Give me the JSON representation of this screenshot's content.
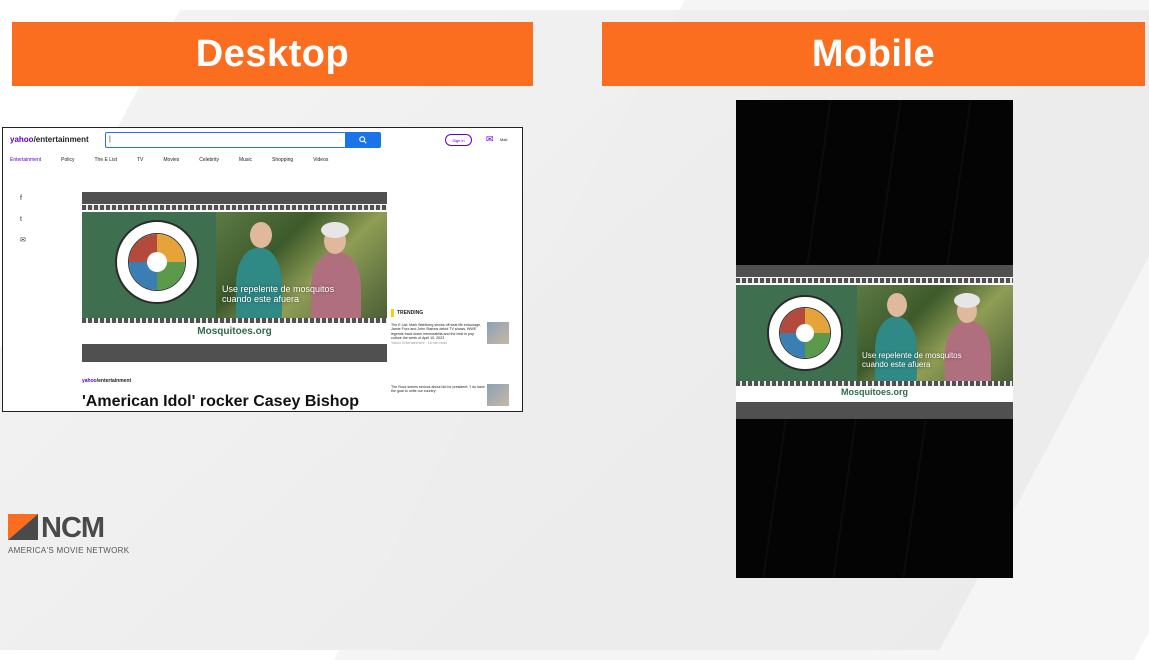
{
  "headers": {
    "desktop": "Desktop",
    "mobile": "Mobile"
  },
  "desktop": {
    "brand_prefix": "yahoo",
    "brand_rest": "/entertainment",
    "search_value": "|",
    "search_icon": "search-icon",
    "signin": "Sign in",
    "mail": "Mail",
    "nav": [
      "Entertainment",
      "Policy",
      "The E List",
      "TV",
      "Movies",
      "Celebrity",
      "Music",
      "Shopping",
      "Videos"
    ],
    "social": [
      "f",
      "t",
      "✉"
    ],
    "ad": {
      "caption_line1": "Use repelente de mosquitos",
      "caption_line2": "cuando este afuera",
      "url": "Mosquitoes.org"
    },
    "trending": {
      "label": "TRENDING",
      "items": [
        {
          "text": "The E List: Mark Wahlberg shows off seat life entourage, Jamie Foxx and John Stamos debut TV shows, WWE legends track down memorabilia and the best in pop culture the week of April 10, 2023",
          "meta": "Yahoo Entertainment · 16 min read"
        },
        {
          "text": "The Rock seems serious about bid for president: 'I do have the goal to unite our country'",
          "meta": ""
        }
      ]
    },
    "article_brand_prefix": "yahoo",
    "article_brand_rest": "/entertainment",
    "headline": "'American Idol' rocker Casey Bishop"
  },
  "mobile": {
    "ad": {
      "caption_line1": "Use repelente de mosquitos",
      "caption_line2": "cuando este afuera",
      "url": "Mosquitoes.org"
    }
  },
  "logo": {
    "name": "NCM",
    "tagline": "AMERICA'S MOVIE NETWORK"
  },
  "colors": {
    "accent_orange": "#fb6e20",
    "yahoo_purple": "#6001d2",
    "ad_green": "#3e6f4f"
  }
}
